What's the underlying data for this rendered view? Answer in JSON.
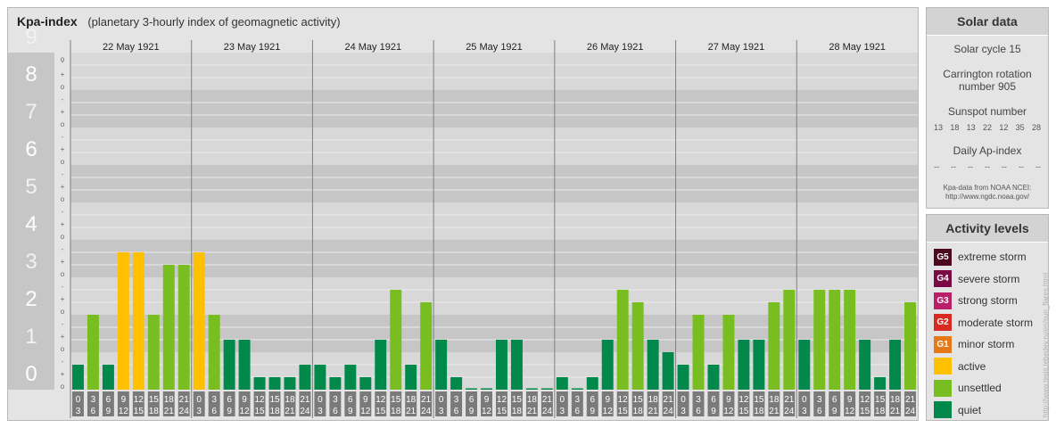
{
  "header": {
    "title": "Kpa-index",
    "subtitle": "(planetary 3-hourly index of geomagnetic activity)"
  },
  "chart_data": {
    "type": "bar",
    "ylim": [
      0,
      9
    ],
    "y_major_ticks": [
      "0",
      "1",
      "2",
      "3",
      "4",
      "5",
      "6",
      "7",
      "8",
      "9"
    ],
    "y_minor_labels": [
      "o",
      "+",
      "-"
    ],
    "days": [
      "22 May 1921",
      "23 May 1921",
      "24 May 1921",
      "25 May 1921",
      "26 May 1921",
      "27 May 1921",
      "28 May 1921"
    ],
    "interval_start_labels": [
      "0",
      "3",
      "6",
      "9",
      "12",
      "15",
      "18",
      "21"
    ],
    "interval_end_labels": [
      "3",
      "6",
      "9",
      "12",
      "15",
      "18",
      "21",
      "24"
    ],
    "series": [
      {
        "values": [
          [
            0.667,
            2.0,
            0.667,
            3.667,
            3.667,
            2.0,
            3.333,
            3.333
          ],
          [
            3.667,
            2.0,
            1.333,
            1.333,
            0.333,
            0.333,
            0.333,
            0.667
          ],
          [
            0.667,
            0.333,
            0.667,
            0.333,
            1.333,
            2.667,
            0.667,
            2.333
          ],
          [
            1.333,
            0.333,
            0.0,
            0.0,
            1.333,
            1.333,
            0.0,
            0.0
          ],
          [
            0.333,
            0.0,
            0.333,
            1.333,
            2.667,
            2.333,
            1.333,
            1.0
          ],
          [
            0.667,
            2.0,
            0.667,
            2.0,
            1.333,
            1.333,
            2.333,
            2.667
          ],
          [
            1.333,
            2.667,
            2.667,
            2.667,
            1.333,
            0.333,
            1.333,
            2.333
          ]
        ]
      }
    ],
    "level_colors": {
      "quiet": "#00894a",
      "unsettled": "#78be21",
      "active": "#ffc000"
    }
  },
  "solar": {
    "title": "Solar data",
    "cycle": "Solar cycle 15",
    "carrington_line1": "Carrington rotation",
    "carrington_line2": "number 905",
    "sunspot_title": "Sunspot number",
    "sunspot_values": [
      "13",
      "18",
      "13",
      "22",
      "12",
      "35",
      "28"
    ],
    "ap_title": "Daily Ap-index",
    "ap_values": [
      "--",
      "--",
      "--",
      "--",
      "--",
      "--",
      "--"
    ],
    "source_line1": "Kpa-data from NOAA NCEI:",
    "source_line2": "http://www.ngdc.noaa.gov/"
  },
  "activity": {
    "title": "Activity levels",
    "items": [
      {
        "badge": "G5",
        "label": "extreme storm",
        "color": "#4b0820"
      },
      {
        "badge": "G4",
        "label": "severe storm",
        "color": "#7a0a45"
      },
      {
        "badge": "G3",
        "label": "strong storm",
        "color": "#bc1f6a"
      },
      {
        "badge": "G2",
        "label": "moderate storm",
        "color": "#d92a22"
      },
      {
        "badge": "G1",
        "label": "minor storm",
        "color": "#e57818"
      },
      {
        "badge": "",
        "label": "active",
        "color": "#ffc000"
      },
      {
        "badge": "",
        "label": "unsettled",
        "color": "#78be21"
      },
      {
        "badge": "",
        "label": "quiet",
        "color": "#00894a"
      }
    ]
  },
  "watermark": "http://www.tesis.lebedev.ru/en/sun_flares.html"
}
